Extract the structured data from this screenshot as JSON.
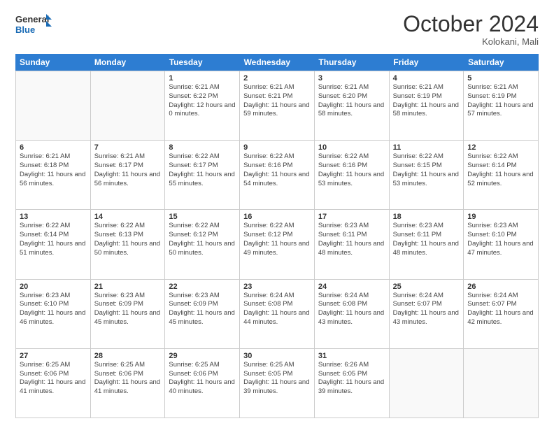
{
  "header": {
    "logo_line1": "General",
    "logo_line2": "Blue",
    "month_title": "October 2024",
    "location": "Kolokani, Mali"
  },
  "weekdays": [
    "Sunday",
    "Monday",
    "Tuesday",
    "Wednesday",
    "Thursday",
    "Friday",
    "Saturday"
  ],
  "weeks": [
    [
      {
        "day": "",
        "info": ""
      },
      {
        "day": "",
        "info": ""
      },
      {
        "day": "1",
        "info": "Sunrise: 6:21 AM\nSunset: 6:22 PM\nDaylight: 12 hours and 0 minutes."
      },
      {
        "day": "2",
        "info": "Sunrise: 6:21 AM\nSunset: 6:21 PM\nDaylight: 11 hours and 59 minutes."
      },
      {
        "day": "3",
        "info": "Sunrise: 6:21 AM\nSunset: 6:20 PM\nDaylight: 11 hours and 58 minutes."
      },
      {
        "day": "4",
        "info": "Sunrise: 6:21 AM\nSunset: 6:19 PM\nDaylight: 11 hours and 58 minutes."
      },
      {
        "day": "5",
        "info": "Sunrise: 6:21 AM\nSunset: 6:19 PM\nDaylight: 11 hours and 57 minutes."
      }
    ],
    [
      {
        "day": "6",
        "info": "Sunrise: 6:21 AM\nSunset: 6:18 PM\nDaylight: 11 hours and 56 minutes."
      },
      {
        "day": "7",
        "info": "Sunrise: 6:21 AM\nSunset: 6:17 PM\nDaylight: 11 hours and 56 minutes."
      },
      {
        "day": "8",
        "info": "Sunrise: 6:22 AM\nSunset: 6:17 PM\nDaylight: 11 hours and 55 minutes."
      },
      {
        "day": "9",
        "info": "Sunrise: 6:22 AM\nSunset: 6:16 PM\nDaylight: 11 hours and 54 minutes."
      },
      {
        "day": "10",
        "info": "Sunrise: 6:22 AM\nSunset: 6:16 PM\nDaylight: 11 hours and 53 minutes."
      },
      {
        "day": "11",
        "info": "Sunrise: 6:22 AM\nSunset: 6:15 PM\nDaylight: 11 hours and 53 minutes."
      },
      {
        "day": "12",
        "info": "Sunrise: 6:22 AM\nSunset: 6:14 PM\nDaylight: 11 hours and 52 minutes."
      }
    ],
    [
      {
        "day": "13",
        "info": "Sunrise: 6:22 AM\nSunset: 6:14 PM\nDaylight: 11 hours and 51 minutes."
      },
      {
        "day": "14",
        "info": "Sunrise: 6:22 AM\nSunset: 6:13 PM\nDaylight: 11 hours and 50 minutes."
      },
      {
        "day": "15",
        "info": "Sunrise: 6:22 AM\nSunset: 6:12 PM\nDaylight: 11 hours and 50 minutes."
      },
      {
        "day": "16",
        "info": "Sunrise: 6:22 AM\nSunset: 6:12 PM\nDaylight: 11 hours and 49 minutes."
      },
      {
        "day": "17",
        "info": "Sunrise: 6:23 AM\nSunset: 6:11 PM\nDaylight: 11 hours and 48 minutes."
      },
      {
        "day": "18",
        "info": "Sunrise: 6:23 AM\nSunset: 6:11 PM\nDaylight: 11 hours and 48 minutes."
      },
      {
        "day": "19",
        "info": "Sunrise: 6:23 AM\nSunset: 6:10 PM\nDaylight: 11 hours and 47 minutes."
      }
    ],
    [
      {
        "day": "20",
        "info": "Sunrise: 6:23 AM\nSunset: 6:10 PM\nDaylight: 11 hours and 46 minutes."
      },
      {
        "day": "21",
        "info": "Sunrise: 6:23 AM\nSunset: 6:09 PM\nDaylight: 11 hours and 45 minutes."
      },
      {
        "day": "22",
        "info": "Sunrise: 6:23 AM\nSunset: 6:09 PM\nDaylight: 11 hours and 45 minutes."
      },
      {
        "day": "23",
        "info": "Sunrise: 6:24 AM\nSunset: 6:08 PM\nDaylight: 11 hours and 44 minutes."
      },
      {
        "day": "24",
        "info": "Sunrise: 6:24 AM\nSunset: 6:08 PM\nDaylight: 11 hours and 43 minutes."
      },
      {
        "day": "25",
        "info": "Sunrise: 6:24 AM\nSunset: 6:07 PM\nDaylight: 11 hours and 43 minutes."
      },
      {
        "day": "26",
        "info": "Sunrise: 6:24 AM\nSunset: 6:07 PM\nDaylight: 11 hours and 42 minutes."
      }
    ],
    [
      {
        "day": "27",
        "info": "Sunrise: 6:25 AM\nSunset: 6:06 PM\nDaylight: 11 hours and 41 minutes."
      },
      {
        "day": "28",
        "info": "Sunrise: 6:25 AM\nSunset: 6:06 PM\nDaylight: 11 hours and 41 minutes."
      },
      {
        "day": "29",
        "info": "Sunrise: 6:25 AM\nSunset: 6:06 PM\nDaylight: 11 hours and 40 minutes."
      },
      {
        "day": "30",
        "info": "Sunrise: 6:25 AM\nSunset: 6:05 PM\nDaylight: 11 hours and 39 minutes."
      },
      {
        "day": "31",
        "info": "Sunrise: 6:26 AM\nSunset: 6:05 PM\nDaylight: 11 hours and 39 minutes."
      },
      {
        "day": "",
        "info": ""
      },
      {
        "day": "",
        "info": ""
      }
    ]
  ]
}
